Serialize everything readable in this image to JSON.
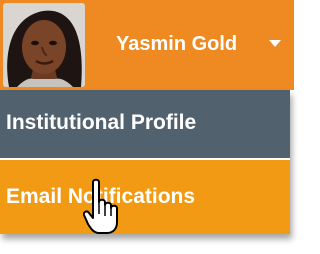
{
  "header": {
    "user_name": "Yasmin Gold",
    "avatar_icon": "user-avatar-photo",
    "dropdown_icon": "caret-down-icon",
    "accent_color": "#ef8a22"
  },
  "menu": {
    "items": [
      {
        "label": "Institutional Profile",
        "color": "#51616d"
      },
      {
        "label": "Email Notifications",
        "color": "#f29a14",
        "hovered": true
      }
    ]
  },
  "cursor": {
    "icon": "hand-pointer-icon"
  }
}
